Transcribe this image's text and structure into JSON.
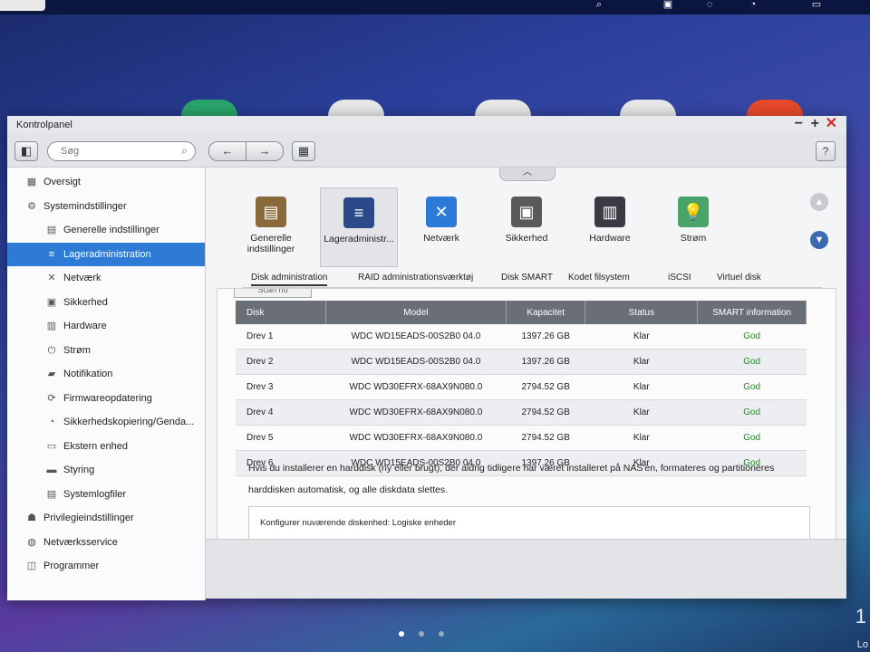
{
  "window": {
    "title": "Kontrolpanel"
  },
  "window_controls": {
    "minimize": "−",
    "maximize": "+",
    "close": "✕"
  },
  "toolbar": {
    "search_placeholder": "Søg",
    "back": "←",
    "forward": "→",
    "help": "?"
  },
  "sidebar": {
    "items": [
      {
        "label": "Oversigt",
        "level": 0,
        "icon": "grid-icon",
        "glyph": "▦"
      },
      {
        "label": "Systemindstillinger",
        "level": 0,
        "icon": "gear-icon",
        "glyph": "⚙"
      },
      {
        "label": "Generelle indstillinger",
        "level": 1,
        "icon": "settings-doc-icon",
        "glyph": "▤"
      },
      {
        "label": "Lageradministration",
        "level": 1,
        "icon": "database-icon",
        "glyph": "≡",
        "selected": true
      },
      {
        "label": "Netværk",
        "level": 1,
        "icon": "network-icon",
        "glyph": "✕"
      },
      {
        "label": "Sikkerhed",
        "level": 1,
        "icon": "lock-icon",
        "glyph": "▣"
      },
      {
        "label": "Hardware",
        "level": 1,
        "icon": "hardware-icon",
        "glyph": "▥"
      },
      {
        "label": "Strøm",
        "level": 1,
        "icon": "power-icon",
        "glyph": "⏻"
      },
      {
        "label": "Notifikation",
        "level": 1,
        "icon": "notification-icon",
        "glyph": "▰"
      },
      {
        "label": "Firmwareopdatering",
        "level": 1,
        "icon": "firmware-icon",
        "glyph": "⟳"
      },
      {
        "label": "Sikkerhedskopiering/Genda...",
        "level": 1,
        "icon": "backup-icon",
        "glyph": "◔"
      },
      {
        "label": "Ekstern enhed",
        "level": 1,
        "icon": "external-device-icon",
        "glyph": "▭"
      },
      {
        "label": "Styring",
        "level": 1,
        "icon": "monitor-icon",
        "glyph": "▬"
      },
      {
        "label": "Systemlogfiler",
        "level": 1,
        "icon": "log-icon",
        "glyph": "▤"
      },
      {
        "label": "Privilegieindstillinger",
        "level": 0,
        "icon": "user-icon",
        "glyph": "☗"
      },
      {
        "label": "Netværksservice",
        "level": 0,
        "icon": "globe-icon",
        "glyph": "◍"
      },
      {
        "label": "Programmer",
        "level": 0,
        "icon": "apps-icon",
        "glyph": "◫"
      }
    ]
  },
  "categories": [
    {
      "label": "Generelle indstillinger",
      "icon": "settings-doc-icon",
      "glyph": "▤",
      "color": "#8a6a3a"
    },
    {
      "label": "Lageradministr...",
      "icon": "database-icon",
      "glyph": "≡",
      "color": "#2a4a8a",
      "selected": true
    },
    {
      "label": "Netværk",
      "icon": "network-icon",
      "glyph": "✕",
      "color": "#2a7ad6"
    },
    {
      "label": "Sikkerhed",
      "icon": "lock-icon",
      "glyph": "▣",
      "color": "#5a5a5a"
    },
    {
      "label": "Hardware",
      "icon": "hardware-icon",
      "glyph": "▥",
      "color": "#3a3a44"
    },
    {
      "label": "Strøm",
      "icon": "power-icon",
      "glyph": "💡",
      "color": "#4aa46a"
    }
  ],
  "tabs": [
    {
      "label": "Disk administration",
      "active": true
    },
    {
      "label": "RAID administrationsværktøj"
    },
    {
      "label": "Disk SMART"
    },
    {
      "label": "Kodet filsystem"
    },
    {
      "label": "iSCSI"
    },
    {
      "label": "Virtuel disk"
    }
  ],
  "scan_button": "Scan nu",
  "disk_table": {
    "columns": [
      "Disk",
      "Model",
      "Kapacitet",
      "Status",
      "SMART information"
    ],
    "rows": [
      [
        "Drev 1",
        "WDC WD15EADS-00S2B0 04.0",
        "1397.26 GB",
        "Klar",
        "God"
      ],
      [
        "Drev 2",
        "WDC WD15EADS-00S2B0 04.0",
        "1397.26 GB",
        "Klar",
        "God"
      ],
      [
        "Drev 3",
        "WDC WD30EFRX-68AX9N080.0",
        "2794.52 GB",
        "Klar",
        "God"
      ],
      [
        "Drev 4",
        "WDC WD30EFRX-68AX9N080.0",
        "2794.52 GB",
        "Klar",
        "God"
      ],
      [
        "Drev 5",
        "WDC WD30EFRX-68AX9N080.0",
        "2794.52 GB",
        "Klar",
        "God"
      ],
      [
        "Drev 6",
        "WDC WD15EADS-00S2B0 04.0",
        "1397.26 GB",
        "Klar",
        "God"
      ]
    ]
  },
  "notice": "Hvis du installerer en harddisk (ny eller brugt), der aldrig tidligere har været installeret på NAS'en, formateres og partitioneres harddisken automatisk, og alle diskdata slettes.",
  "config_section": "Konfigurer nuværende diskenhed: Logiske enheder",
  "desktop": {
    "corner_number": "1",
    "corner_text": "Lo"
  },
  "colors": {
    "accent": "#2e7bd6",
    "good": "#2a8a2a",
    "table_header": "#6a6e76"
  }
}
